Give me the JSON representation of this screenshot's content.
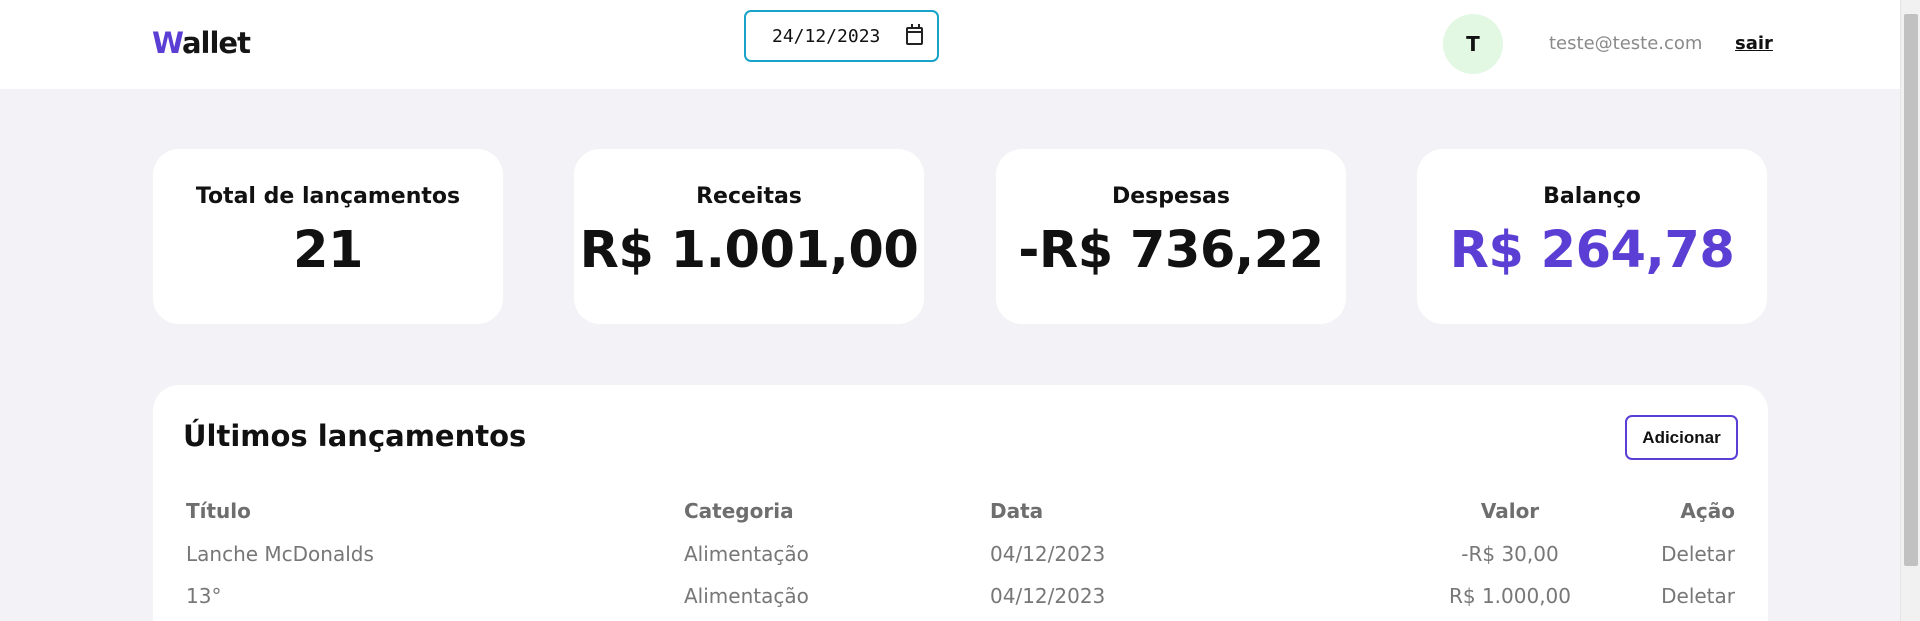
{
  "header": {
    "logo_initial": "W",
    "logo_rest": "allet",
    "date_value": "24/12/2023",
    "avatar_initial": "T",
    "email": "teste@teste.com",
    "logout_label": "sair"
  },
  "summary": [
    {
      "label": "Total de lançamentos",
      "value": "21"
    },
    {
      "label": "Receitas",
      "value": "R$ 1.001,00"
    },
    {
      "label": "Despesas",
      "value": "-R$ 736,22"
    },
    {
      "label": "Balanço",
      "value": "R$ 264,78"
    }
  ],
  "transactions": {
    "title": "Últimos lançamentos",
    "add_label": "Adicionar",
    "columns": {
      "title": "Título",
      "category": "Categoria",
      "date": "Data",
      "value": "Valor",
      "action": "Ação"
    },
    "rows": [
      {
        "title": "Lanche McDonalds",
        "category": "Alimentação",
        "date": "04/12/2023",
        "value": "-R$ 30,00",
        "action": "Deletar"
      },
      {
        "title": "13°",
        "category": "Alimentação",
        "date": "04/12/2023",
        "value": "R$ 1.000,00",
        "action": "Deletar"
      }
    ]
  },
  "colors": {
    "accent": "#5b3fd4",
    "date_border": "#1aa3c8",
    "avatar_bg": "#e2f8e3",
    "page_bg": "#f3f3f7"
  }
}
